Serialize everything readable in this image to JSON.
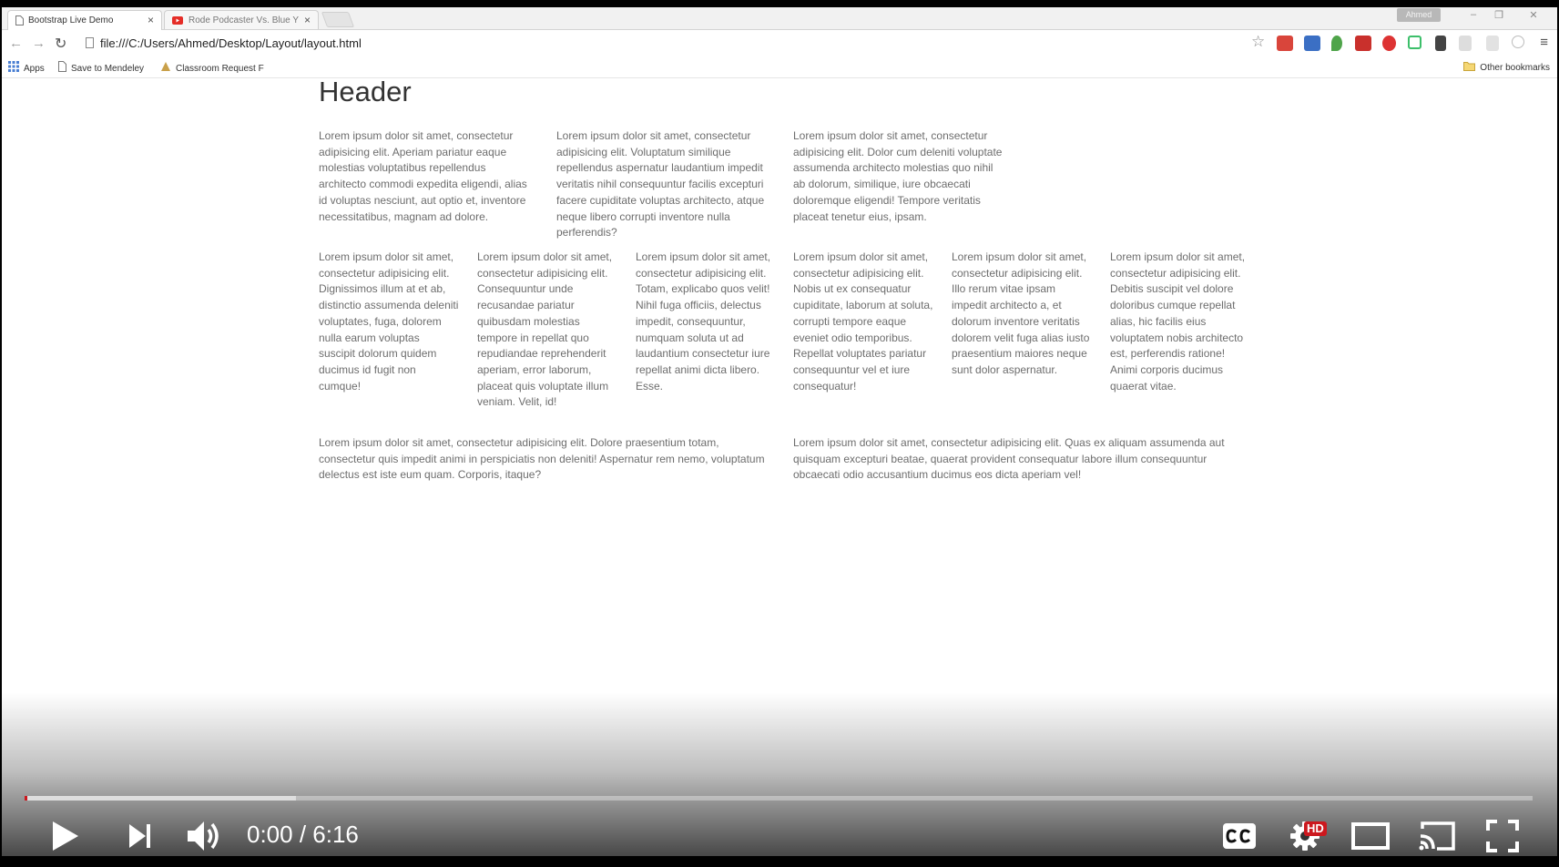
{
  "browser": {
    "tabs": [
      {
        "title": "Bootstrap Live Demo",
        "active": true
      },
      {
        "title": "Rode Podcaster Vs. Blue Y",
        "active": false
      }
    ],
    "window_user": "Ahmed",
    "url": "file:///C:/Users/Ahmed/Desktop/Layout/layout.html",
    "bookmarks": [
      "Apps",
      "Save to Mendeley",
      "Classroom Request F"
    ],
    "other_bookmarks": "Other bookmarks"
  },
  "page": {
    "header": "Header",
    "row1": [
      "Lorem ipsum dolor sit amet, consectetur adipisicing elit. Aperiam pariatur eaque molestias voluptatibus repellendus architecto commodi expedita eligendi, alias id voluptas nesciunt, aut optio et, inventore necessitatibus, magnam ad dolore.",
      "Lorem ipsum dolor sit amet, consectetur adipisicing elit. Voluptatum similique repellendus aspernatur laudantium impedit veritatis nihil consequuntur facilis excepturi facere cupiditate voluptas architecto, atque neque libero corrupti inventore nulla perferendis?",
      "Lorem ipsum dolor sit amet, consectetur adipisicing elit. Dolor cum deleniti voluptate assumenda architecto molestias quo nihil ab dolorum, similique, iure obcaecati doloremque eligendi! Tempore veritatis placeat tenetur eius, ipsam."
    ],
    "row2": [
      "Lorem ipsum dolor sit amet, consectetur adipisicing elit. Dignissimos illum at et ab, distinctio assumenda deleniti voluptates, fuga, dolorem nulla earum voluptas suscipit dolorum quidem ducimus id fugit non cumque!",
      "Lorem ipsum dolor sit amet, consectetur adipisicing elit. Consequuntur unde recusandae pariatur quibusdam molestias tempore in repellat quo repudiandae reprehenderit aperiam, error laborum, placeat quis voluptate illum veniam. Velit, id!",
      "Lorem ipsum dolor sit amet, consectetur adipisicing elit. Totam, explicabo quos velit! Nihil fuga officiis, delectus impedit, consequuntur, numquam soluta ut ad laudantium consectetur iure repellat animi dicta libero. Esse.",
      "Lorem ipsum dolor sit amet, consectetur adipisicing elit. Nobis ut ex consequatur cupiditate, laborum at soluta, corrupti tempore eaque eveniet odio temporibus. Repellat voluptates pariatur consequuntur vel et iure consequatur!",
      "Lorem ipsum dolor sit amet, consectetur adipisicing elit. Illo rerum vitae ipsam impedit architecto a, et dolorum inventore veritatis dolorem velit fuga alias iusto praesentium maiores neque sunt dolor aspernatur.",
      "Lorem ipsum dolor sit amet, consectetur adipisicing elit. Debitis suscipit vel dolore doloribus cumque repellat alias, hic facilis eius voluptatem nobis architecto est, perferendis ratione! Animi corporis ducimus quaerat vitae."
    ],
    "row3": [
      "Lorem ipsum dolor sit amet, consectetur adipisicing elit. Dolore praesentium totam, consectetur quis impedit animi in perspiciatis non deleniti! Aspernatur rem nemo, voluptatum delectus est iste eum quam. Corporis, itaque?",
      "Lorem ipsum dolor sit amet, consectetur adipisicing elit. Quas ex aliquam assumenda aut quisquam excepturi beatae, quaerat provident consequatur labore illum consequuntur obcaecati odio accusantium ducimus eos dicta aperiam vel!"
    ]
  },
  "player": {
    "time": "0:00 / 6:16",
    "played_fraction": 0.0,
    "buffered_fraction": 0.18,
    "hd_badge": "HD",
    "accent": "#cc181e",
    "icons": [
      "play-icon",
      "next-icon",
      "volume-icon",
      "captions-icon",
      "settings-icon",
      "theater-icon",
      "cast-icon",
      "fullscreen-icon"
    ]
  }
}
